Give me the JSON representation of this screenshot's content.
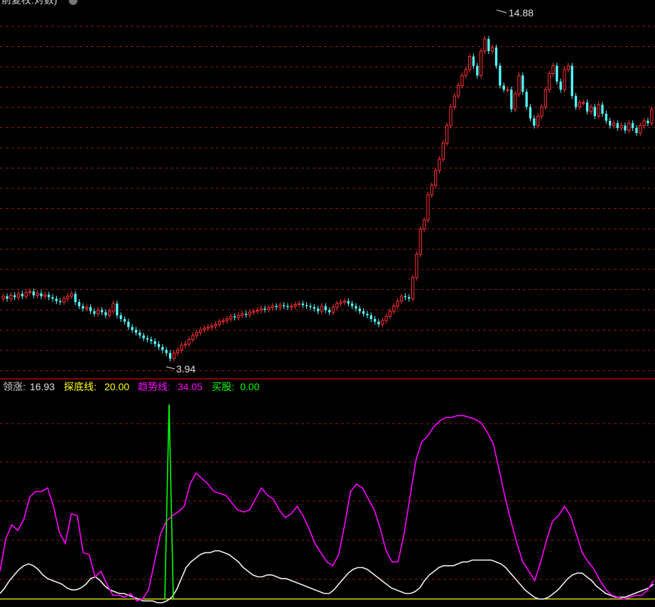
{
  "price_panel": {
    "title": "前复权:对数)",
    "high_label": "14.88",
    "low_label": "3.94"
  },
  "indicator_panel": {
    "items": [
      {
        "label": "领涨:",
        "value": "16.93",
        "color": "#e0e0e0"
      },
      {
        "label": "探底线:",
        "value": "20.00",
        "color": "#ffff00"
      },
      {
        "label": "趋势线:",
        "value": "34.05",
        "color": "#ff00ff"
      },
      {
        "label": "买股:",
        "value": "0.00",
        "color": "#00ff00"
      }
    ]
  },
  "colors": {
    "up": "#ff3030",
    "down": "#54ffff",
    "grid": "#8b1a1a",
    "divider": "#b00000",
    "trend": "#ff00ff",
    "lead": "#f0f0f0",
    "bottom_line": "#ffff00",
    "buy": "#00ff00"
  },
  "chart_data": [
    {
      "type": "candlestick",
      "scale": "log",
      "ylim": [
        3.7,
        16.5
      ],
      "marked_high": 14.88,
      "marked_low": 3.94,
      "close": [
        5.1,
        5.05,
        5.12,
        5.08,
        5.15,
        5.1,
        5.18,
        5.2,
        5.12,
        5.16,
        5.1,
        5.13,
        5.08,
        5.05,
        5.0,
        4.98,
        5.05,
        5.1,
        5.15,
        4.98,
        4.9,
        4.85,
        4.88,
        4.8,
        4.75,
        4.82,
        4.78,
        4.72,
        4.8,
        4.95,
        4.72,
        4.65,
        4.6,
        4.5,
        4.45,
        4.4,
        4.35,
        4.3,
        4.28,
        4.25,
        4.2,
        4.15,
        4.1,
        4.05,
        3.96,
        4.05,
        4.1,
        4.18,
        4.2,
        4.28,
        4.35,
        4.4,
        4.45,
        4.48,
        4.5,
        4.52,
        4.55,
        4.6,
        4.62,
        4.65,
        4.7,
        4.68,
        4.72,
        4.75,
        4.73,
        4.78,
        4.8,
        4.82,
        4.85,
        4.83,
        4.87,
        4.9,
        4.88,
        4.92,
        4.9,
        4.88,
        4.9,
        4.93,
        4.95,
        4.92,
        4.9,
        4.88,
        4.85,
        4.8,
        4.9,
        4.82,
        4.78,
        4.88,
        4.95,
        4.98,
        5.0,
        4.95,
        4.9,
        4.85,
        4.8,
        4.75,
        4.72,
        4.65,
        4.6,
        4.55,
        4.62,
        4.7,
        4.8,
        4.9,
        5.0,
        5.1,
        5.08,
        5.05,
        5.5,
        6.05,
        6.7,
        6.95,
        7.7,
        8.0,
        8.5,
        8.9,
        9.5,
        10.2,
        11.0,
        11.5,
        12.0,
        12.5,
        12.8,
        13.5,
        13.0,
        12.5,
        13.8,
        14.5,
        13.8,
        14.0,
        13.0,
        12.0,
        11.8,
        11.8,
        10.9,
        11.6,
        12.5,
        11.7,
        11.0,
        10.5,
        10.2,
        10.6,
        11.0,
        11.8,
        12.6,
        13.0,
        12.2,
        11.8,
        12.8,
        13.0,
        11.5,
        11.0,
        11.2,
        11.2,
        10.8,
        11.0,
        10.6,
        11.1,
        10.7,
        10.4,
        10.2,
        10.3,
        10.1,
        10.2,
        10.0,
        10.3,
        10.1,
        9.9,
        10.2,
        10.4,
        10.3,
        10.9
      ],
      "count": 174
    },
    {
      "type": "line",
      "ylim": [
        -2,
        110
      ],
      "series": [
        {
          "name": "领涨",
          "color": "#f0f0f0",
          "values": [
            3,
            6,
            10,
            13,
            16,
            18,
            19,
            18,
            16,
            13,
            11,
            10,
            9,
            8,
            6,
            5,
            5,
            6,
            8,
            11,
            12,
            10,
            7,
            5,
            4,
            3,
            3,
            2,
            1,
            0,
            -1,
            -1,
            -1,
            -2,
            -2,
            -1,
            1,
            5,
            11,
            17,
            20,
            22,
            24,
            25,
            25,
            26,
            26,
            25,
            24,
            22,
            20,
            17,
            15,
            13,
            12,
            12,
            13,
            13,
            12,
            11,
            11,
            10,
            9,
            8,
            7,
            6,
            5,
            4,
            3,
            3,
            5,
            8,
            11,
            14,
            16,
            17,
            17,
            16,
            14,
            12,
            10,
            8,
            6,
            5,
            4,
            3,
            3,
            4,
            6,
            10,
            13,
            15,
            17,
            18,
            18,
            18,
            19,
            20,
            20,
            21,
            21,
            21,
            21,
            21,
            20,
            19,
            17,
            14,
            11,
            8,
            5,
            3,
            1,
            0,
            0,
            1,
            3,
            5,
            8,
            11,
            13,
            14,
            14,
            12,
            10,
            7,
            5,
            3,
            2,
            1,
            1,
            1,
            2,
            3,
            4,
            5,
            6,
            8
          ]
        },
        {
          "name": "趋势线",
          "color": "#ff00ff",
          "values": [
            15,
            33,
            40,
            37,
            43,
            55,
            58,
            58,
            60,
            50,
            36,
            30,
            46,
            45,
            25,
            24,
            12,
            15,
            8,
            2,
            2,
            1,
            3,
            -1,
            0,
            5,
            20,
            35,
            42,
            45,
            47,
            50,
            62,
            68,
            65,
            62,
            58,
            57,
            56,
            52,
            48,
            47,
            48,
            54,
            60,
            56,
            54,
            48,
            44,
            46,
            50,
            45,
            38,
            30,
            25,
            20,
            18,
            24,
            40,
            58,
            62,
            60,
            54,
            48,
            38,
            26,
            20,
            20,
            35,
            55,
            75,
            85,
            88,
            93,
            96,
            98,
            98,
            99,
            99,
            98,
            97,
            95,
            90,
            84,
            70,
            55,
            42,
            30,
            20,
            15,
            10,
            20,
            32,
            42,
            45,
            50,
            45,
            35,
            25,
            20,
            16,
            10,
            5,
            2,
            1,
            0,
            1,
            2,
            2,
            5,
            10
          ]
        }
      ],
      "buy_spike": 105
    }
  ]
}
